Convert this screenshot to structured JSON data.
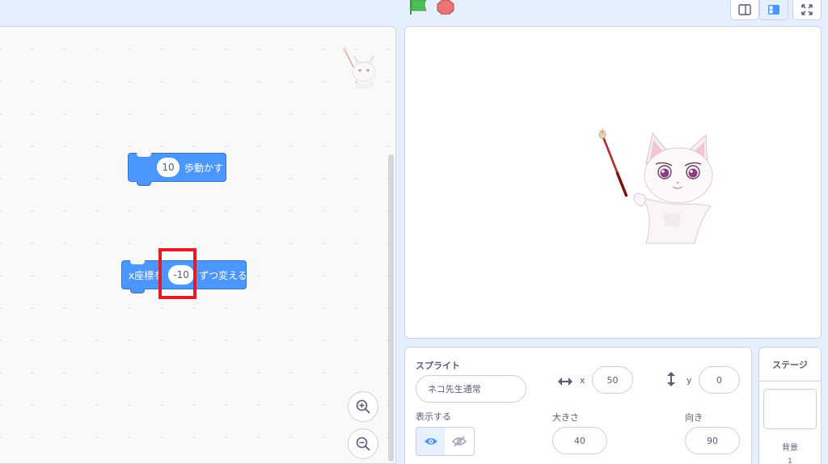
{
  "blocks": {
    "move": {
      "value": "10",
      "label": "歩動かす"
    },
    "change_x": {
      "prefix": "x座標を",
      "value": "-10",
      "suffix": "ずつ変える"
    }
  },
  "sprite_info": {
    "sprite_label": "スプライト",
    "sprite_name": "ネコ先生通常",
    "x_label": "x",
    "x_value": "50",
    "y_label": "y",
    "y_value": "0",
    "show_label": "表示する",
    "size_label": "大きさ",
    "size_value": "40",
    "direction_label": "向き",
    "direction_value": "90"
  },
  "stage_panel": {
    "title": "ステージ",
    "backdrop_label": "背景",
    "backdrop_count": "1"
  },
  "colors": {
    "block_blue": "#4c97ff",
    "green_flag": "#4cbf56",
    "stop": "#ec7373",
    "highlight": "#e51b24",
    "eye_active": "#4c97ff"
  },
  "icons": [
    "green-flag-icon",
    "stop-icon",
    "small-stage-icon",
    "large-stage-icon",
    "fullscreen-icon",
    "zoom-in-icon",
    "zoom-out-icon",
    "arrows-horizontal-icon",
    "arrows-vertical-icon",
    "eye-icon",
    "eye-slash-icon"
  ]
}
